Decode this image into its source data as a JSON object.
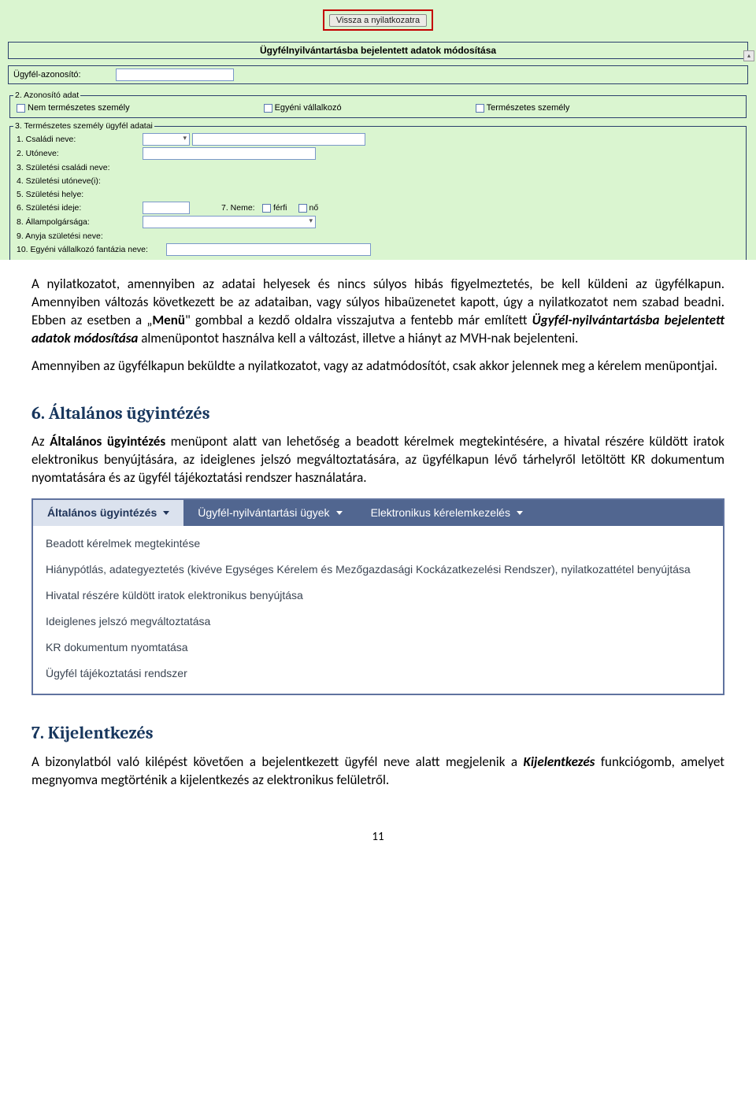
{
  "form": {
    "back_button": "Vissza a nyilatkozatra",
    "panel_title": "Ügyfélnyilvántartásba bejelentett adatok módosítása",
    "ugyfel_azon_label": "Ügyfél-azonosító:",
    "group2_legend": "2.  Azonosító adat",
    "cb_nem_term": "Nem természetes személy",
    "cb_egyeni": "Egyéni vállalkozó",
    "cb_term": "Természetes személy",
    "group3_legend": "3.  Természetes személy ügyfél adatai",
    "f_csaladi": "1. Családi neve:",
    "f_utonev": "2. Utóneve:",
    "f_szul_csaladi": "3. Születési családi neve:",
    "f_szul_utonev": "4. Születési utóneve(i):",
    "f_szul_hely": "5. Születési helye:",
    "f_szul_ideje": "6. Születési ideje:",
    "f_neme": "7. Neme:",
    "f_ferfi": "férfi",
    "f_no": "nő",
    "f_allampolg": "8. Állampolgársága:",
    "f_anyja": "9. Anyja születési neve:",
    "f_fantazia": "10. Egyéni vállalkozó fantázia neve:"
  },
  "body": {
    "p1_a": "A nyilatkozatot, amennyiben az adatai helyesek és nincs súlyos hibás figyelmeztetés, be kell küldeni az ügyfélkapun. Amennyiben változás következett be az adataiban, vagy súlyos hibaüzenetet kapott, úgy a nyilatkozatot nem szabad beadni. Ebben az esetben a „",
    "p1_menu": "Menü",
    "p1_b": "\" gombbal a kezdő oldalra visszajutva a fentebb már említett ",
    "p1_em": "Ügyfél-nyilvántartásba bejelentett adatok módosítása",
    "p1_c": " almenüpontot használva kell a változást, illetve a hiányt az MVH-nak bejelenteni.",
    "p2": "Amennyiben az ügyfélkapun beküldte a nyilatkozatot, vagy az adatmódosítót, csak akkor jelennek meg a kérelem menüpontjai.",
    "h6": "6. Általános ügyintézés",
    "p3_a": "Az ",
    "p3_b": "Általános ügyintézés",
    "p3_c": " menüpont alatt van lehetőség a beadott kérelmek megtekintésére, a hivatal részére küldött iratok elektronikus benyújtására, az ideiglenes jelszó megváltoztatására, az ügyfélkapun lévő tárhelyről letöltött KR dokumentum nyomtatására és az ügyfél tájékoztatási rendszer használatára.",
    "menu": {
      "tab1": "Általános ügyintézés",
      "tab2": "Ügyfél-nyilvántartási ügyek",
      "tab3": "Elektronikus kérelemkezelés",
      "items": [
        "Beadott kérelmek megtekintése",
        "Hiánypótlás, adategyeztetés (kivéve Egységes Kérelem és Mezőgazdasági Kockázatkezelési Rendszer), nyilatkozattétel benyújtása",
        "Hivatal részére küldött iratok elektronikus benyújtása",
        "Ideiglenes jelszó megváltoztatása",
        "KR dokumentum nyomtatása",
        "Ügyfél tájékoztatási rendszer"
      ]
    },
    "h7": "7. Kijelentkezés",
    "p4_a": "A bizonylatból való kilépést követően a bejelentkezett ügyfél neve alatt megjelenik a ",
    "p4_em": "Kijelentkezés",
    "p4_b": " funkciógomb, amelyet megnyomva megtörténik a kijelentkezés az elektronikus felületről.",
    "page_num": "11"
  }
}
